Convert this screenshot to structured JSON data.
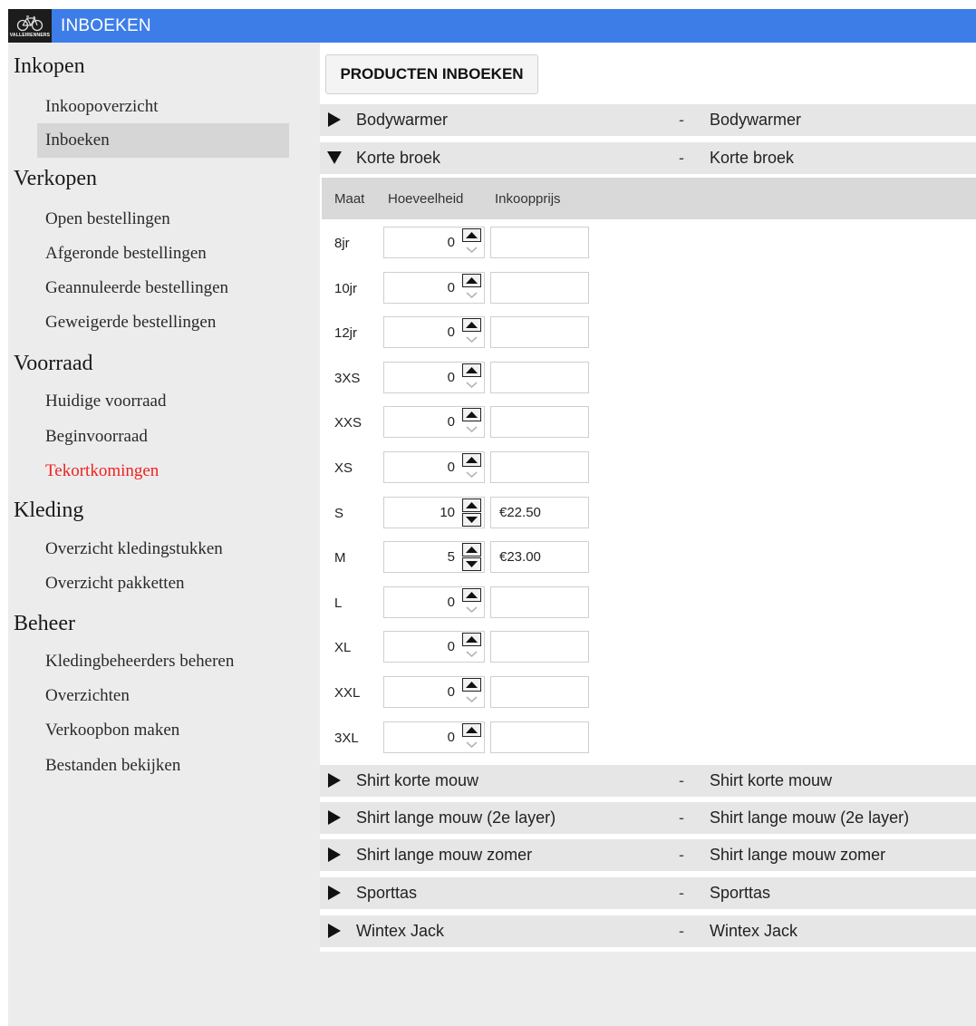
{
  "app": {
    "title": "INBOEKEN",
    "logo_text": "VALLEIRENNERS"
  },
  "sidebar": {
    "sections": [
      {
        "title": "Inkopen",
        "items": [
          {
            "label": "Inkoopoverzicht",
            "selected": false,
            "alert": false
          },
          {
            "label": "Inboeken",
            "selected": true,
            "alert": false
          }
        ]
      },
      {
        "title": "Verkopen",
        "items": [
          {
            "label": "Open bestellingen",
            "selected": false,
            "alert": false
          },
          {
            "label": "Afgeronde bestellingen",
            "selected": false,
            "alert": false
          },
          {
            "label": "Geannuleerde bestellingen",
            "selected": false,
            "alert": false
          },
          {
            "label": "Geweigerde bestellingen",
            "selected": false,
            "alert": false
          }
        ]
      },
      {
        "title": "Voorraad",
        "items": [
          {
            "label": "Huidige voorraad",
            "selected": false,
            "alert": false
          },
          {
            "label": "Beginvoorraad",
            "selected": false,
            "alert": false
          },
          {
            "label": "Tekortkomingen",
            "selected": false,
            "alert": true
          }
        ]
      },
      {
        "title": "Kleding",
        "items": [
          {
            "label": "Overzicht kledingstukken",
            "selected": false,
            "alert": false
          },
          {
            "label": "Overzicht pakketten",
            "selected": false,
            "alert": false
          }
        ]
      },
      {
        "title": "Beheer",
        "items": [
          {
            "label": "Kledingbeheerders beheren",
            "selected": false,
            "alert": false
          },
          {
            "label": "Overzichten",
            "selected": false,
            "alert": false
          },
          {
            "label": "Verkoopbon maken",
            "selected": false,
            "alert": false
          },
          {
            "label": "Bestanden bekijken",
            "selected": false,
            "alert": false
          }
        ]
      }
    ]
  },
  "main": {
    "primary_button": "PRODUCTEN INBOEKEN",
    "products_before": [
      {
        "name": "Bodywarmer",
        "separator": "-",
        "name2": "Bodywarmer",
        "expanded": false
      },
      {
        "name": "Korte broek",
        "separator": "-",
        "name2": "Korte broek",
        "expanded": true
      }
    ],
    "size_table": {
      "headers": {
        "size": "Maat",
        "quantity": "Hoeveelheid",
        "price": "Inkoopprijs"
      },
      "rows": [
        {
          "size": "8jr",
          "quantity": "0",
          "price": ""
        },
        {
          "size": "10jr",
          "quantity": "0",
          "price": ""
        },
        {
          "size": "12jr",
          "quantity": "0",
          "price": ""
        },
        {
          "size": "3XS",
          "quantity": "0",
          "price": ""
        },
        {
          "size": "XXS",
          "quantity": "0",
          "price": ""
        },
        {
          "size": "XS",
          "quantity": "0",
          "price": ""
        },
        {
          "size": "S",
          "quantity": "10",
          "price": "€22.50"
        },
        {
          "size": "M",
          "quantity": "5",
          "price": "€23.00"
        },
        {
          "size": "L",
          "quantity": "0",
          "price": ""
        },
        {
          "size": "XL",
          "quantity": "0",
          "price": ""
        },
        {
          "size": "XXL",
          "quantity": "0",
          "price": ""
        },
        {
          "size": "3XL",
          "quantity": "0",
          "price": ""
        }
      ]
    },
    "products_after": [
      {
        "name": "Shirt korte mouw",
        "separator": "-",
        "name2": "Shirt korte mouw",
        "expanded": false
      },
      {
        "name": "Shirt lange mouw (2e layer)",
        "separator": "-",
        "name2": "Shirt lange mouw (2e layer)",
        "expanded": false
      },
      {
        "name": "Shirt lange mouw zomer",
        "separator": "-",
        "name2": "Shirt lange mouw zomer",
        "expanded": false
      },
      {
        "name": "Sporttas",
        "separator": "-",
        "name2": "Sporttas",
        "expanded": false
      },
      {
        "name": "Wintex Jack",
        "separator": "-",
        "name2": "Wintex Jack",
        "expanded": false
      }
    ]
  },
  "colors": {
    "titlebar": "#3d7de8",
    "alert_text": "#ee2222",
    "sidebar_bg": "#ececec",
    "selected_bg": "#d6d6d6"
  }
}
